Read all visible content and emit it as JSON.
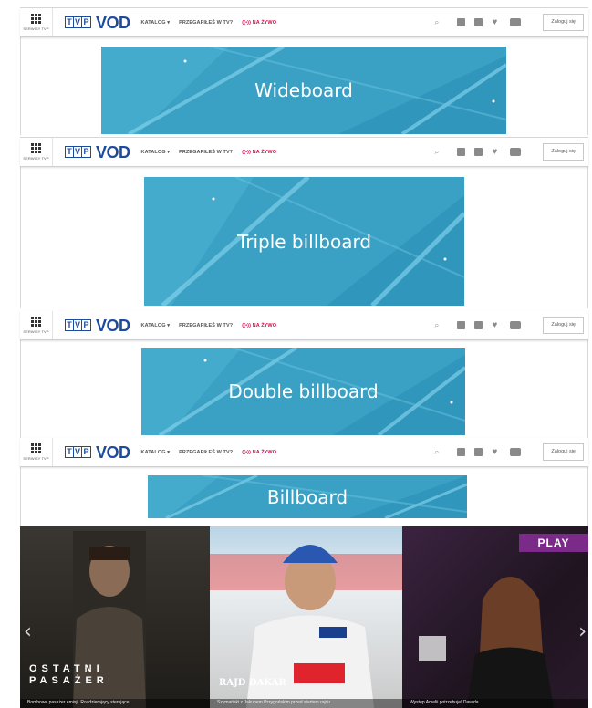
{
  "navbar": {
    "services_label": "SERWISY TVP",
    "logo_tvp": [
      "T",
      "V",
      "P"
    ],
    "logo_vod": "VOD",
    "menu": [
      {
        "label": "KATALOG ▾"
      },
      {
        "label": "PRZEGAPIŁEŚ W TV?"
      },
      {
        "label": "((•)) NA ŻYWO"
      }
    ],
    "login": "Zaloguj się",
    "icons": [
      "search-icon",
      "facebook-icon",
      "instagram-icon",
      "twitter-icon",
      "youtube-icon"
    ]
  },
  "banners": [
    {
      "label": "Wideboard"
    },
    {
      "label": "Triple billboard"
    },
    {
      "label": "Double billboard"
    },
    {
      "label": "Billboard"
    }
  ],
  "hero": {
    "slides": [
      {
        "title_line1": "OSTATNI",
        "title_line2": "PASAŻER",
        "caption": "Bombowe pasażer emisji. Rozdzierający sterujące"
      },
      {
        "title": "RAJD DAKAR",
        "caption": "Szymański z Jakubem Przygońskim przed startem rajdu"
      },
      {
        "badge": "PLAY",
        "caption": "Występ Amelii potrzebuje! Dawida"
      }
    ],
    "prev": "‹",
    "next": "›"
  },
  "colors": {
    "brand_blue": "#1c4a9c",
    "live_red": "#d1114b",
    "banner_blue": "#3aa0c4",
    "play_purple": "#7b2a8a"
  }
}
